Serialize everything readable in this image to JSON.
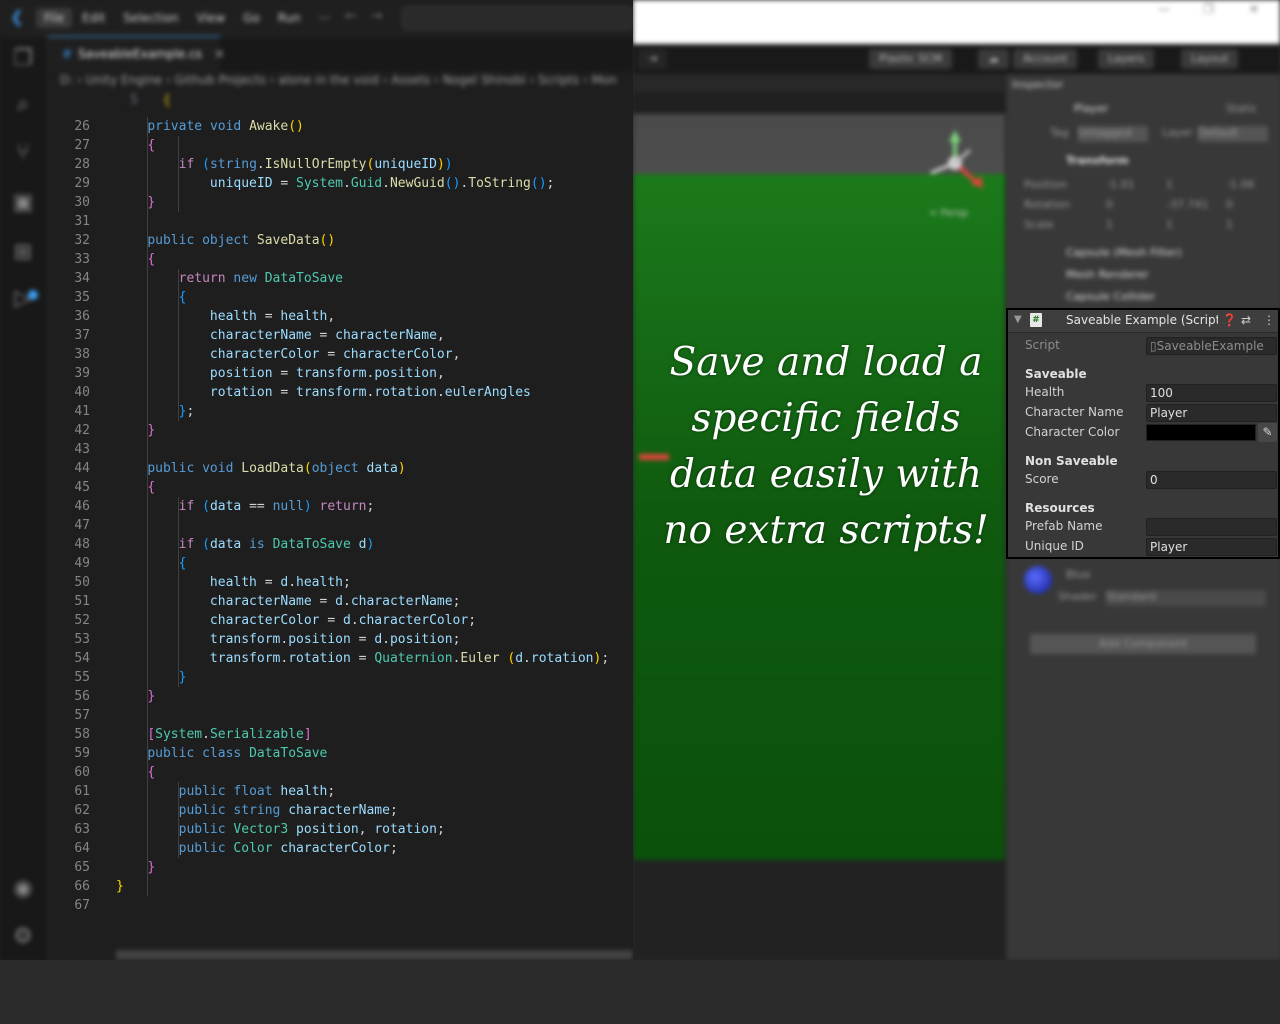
{
  "vscode": {
    "menu": [
      "File",
      "Edit",
      "Selection",
      "View",
      "Go",
      "Run",
      "···"
    ],
    "tab": {
      "filename": "SaveableExample.cs",
      "close": "×"
    },
    "breadcrumbs": "D: › Unity Engine › Github Projects › alone in the void › Assets › Nogel Shinobi › Scripts › Mon",
    "sticky": {
      "line": "5",
      "text": "{"
    },
    "lines": [
      {
        "n": "26",
        "t": [
          [
            "    ",
            "o"
          ],
          [
            "private ",
            "k"
          ],
          [
            "void ",
            "k"
          ],
          [
            "Awake",
            "f"
          ],
          [
            "()",
            "p1"
          ]
        ]
      },
      {
        "n": "27",
        "t": [
          [
            "    ",
            "o"
          ],
          [
            "{",
            "p2"
          ]
        ]
      },
      {
        "n": "28",
        "t": [
          [
            "        ",
            "o"
          ],
          [
            "if ",
            "c"
          ],
          [
            "(",
            "p3"
          ],
          [
            "string",
            "k"
          ],
          [
            ".",
            "o"
          ],
          [
            "IsNullOrEmpty",
            "f"
          ],
          [
            "(",
            "p1"
          ],
          [
            "uniqueID",
            "v"
          ],
          [
            ")",
            "p1"
          ],
          [
            ")",
            "p3"
          ]
        ]
      },
      {
        "n": "29",
        "t": [
          [
            "            ",
            "o"
          ],
          [
            "uniqueID ",
            "v"
          ],
          [
            "= ",
            "o"
          ],
          [
            "System",
            "t"
          ],
          [
            ".",
            "o"
          ],
          [
            "Guid",
            "t"
          ],
          [
            ".",
            "o"
          ],
          [
            "NewGuid",
            "f"
          ],
          [
            "()",
            "p3"
          ],
          [
            ".",
            "o"
          ],
          [
            "ToString",
            "f"
          ],
          [
            "()",
            "p3"
          ],
          [
            ";",
            "o"
          ]
        ]
      },
      {
        "n": "30",
        "t": [
          [
            "    ",
            "o"
          ],
          [
            "}",
            "p2"
          ]
        ]
      },
      {
        "n": "31",
        "t": []
      },
      {
        "n": "32",
        "t": [
          [
            "    ",
            "o"
          ],
          [
            "public ",
            "k"
          ],
          [
            "object ",
            "k"
          ],
          [
            "SaveData",
            "f"
          ],
          [
            "()",
            "p1"
          ]
        ]
      },
      {
        "n": "33",
        "t": [
          [
            "    ",
            "o"
          ],
          [
            "{",
            "p2"
          ]
        ]
      },
      {
        "n": "34",
        "t": [
          [
            "        ",
            "o"
          ],
          [
            "return ",
            "c"
          ],
          [
            "new ",
            "k"
          ],
          [
            "DataToSave",
            "t"
          ]
        ]
      },
      {
        "n": "35",
        "t": [
          [
            "        ",
            "o"
          ],
          [
            "{",
            "p3"
          ]
        ]
      },
      {
        "n": "36",
        "t": [
          [
            "            ",
            "o"
          ],
          [
            "health ",
            "v"
          ],
          [
            "= ",
            "o"
          ],
          [
            "health",
            "v"
          ],
          [
            ",",
            "o"
          ]
        ]
      },
      {
        "n": "37",
        "t": [
          [
            "            ",
            "o"
          ],
          [
            "characterName ",
            "v"
          ],
          [
            "= ",
            "o"
          ],
          [
            "characterName",
            "v"
          ],
          [
            ",",
            "o"
          ]
        ]
      },
      {
        "n": "38",
        "t": [
          [
            "            ",
            "o"
          ],
          [
            "characterColor ",
            "v"
          ],
          [
            "= ",
            "o"
          ],
          [
            "characterColor",
            "v"
          ],
          [
            ",",
            "o"
          ]
        ]
      },
      {
        "n": "39",
        "t": [
          [
            "            ",
            "o"
          ],
          [
            "position ",
            "v"
          ],
          [
            "= ",
            "o"
          ],
          [
            "transform",
            "v"
          ],
          [
            ".",
            "o"
          ],
          [
            "position",
            "v"
          ],
          [
            ",",
            "o"
          ]
        ]
      },
      {
        "n": "40",
        "t": [
          [
            "            ",
            "o"
          ],
          [
            "rotation ",
            "v"
          ],
          [
            "= ",
            "o"
          ],
          [
            "transform",
            "v"
          ],
          [
            ".",
            "o"
          ],
          [
            "rotation",
            "v"
          ],
          [
            ".",
            "o"
          ],
          [
            "eulerAngles",
            "v"
          ]
        ]
      },
      {
        "n": "41",
        "t": [
          [
            "        ",
            "o"
          ],
          [
            "}",
            "p3"
          ],
          [
            ";",
            "o"
          ]
        ]
      },
      {
        "n": "42",
        "t": [
          [
            "    ",
            "o"
          ],
          [
            "}",
            "p2"
          ]
        ]
      },
      {
        "n": "43",
        "t": []
      },
      {
        "n": "44",
        "t": [
          [
            "    ",
            "o"
          ],
          [
            "public ",
            "k"
          ],
          [
            "void ",
            "k"
          ],
          [
            "LoadData",
            "f"
          ],
          [
            "(",
            "p1"
          ],
          [
            "object ",
            "k"
          ],
          [
            "data",
            "v"
          ],
          [
            ")",
            "p1"
          ]
        ]
      },
      {
        "n": "45",
        "t": [
          [
            "    ",
            "o"
          ],
          [
            "{",
            "p2"
          ]
        ]
      },
      {
        "n": "46",
        "t": [
          [
            "        ",
            "o"
          ],
          [
            "if ",
            "c"
          ],
          [
            "(",
            "p3"
          ],
          [
            "data ",
            "v"
          ],
          [
            "== ",
            "o"
          ],
          [
            "null",
            "k"
          ],
          [
            ") ",
            "p3"
          ],
          [
            "return",
            "c"
          ],
          [
            ";",
            "o"
          ]
        ]
      },
      {
        "n": "47",
        "t": []
      },
      {
        "n": "48",
        "t": [
          [
            "        ",
            "o"
          ],
          [
            "if ",
            "c"
          ],
          [
            "(",
            "p3"
          ],
          [
            "data ",
            "v"
          ],
          [
            "is ",
            "k"
          ],
          [
            "DataToSave ",
            "t"
          ],
          [
            "d",
            "v"
          ],
          [
            ")",
            "p3"
          ]
        ]
      },
      {
        "n": "49",
        "t": [
          [
            "        ",
            "o"
          ],
          [
            "{",
            "p3"
          ]
        ]
      },
      {
        "n": "50",
        "t": [
          [
            "            ",
            "o"
          ],
          [
            "health ",
            "v"
          ],
          [
            "= ",
            "o"
          ],
          [
            "d",
            "v"
          ],
          [
            ".",
            "o"
          ],
          [
            "health",
            "v"
          ],
          [
            ";",
            "o"
          ]
        ]
      },
      {
        "n": "51",
        "t": [
          [
            "            ",
            "o"
          ],
          [
            "characterName ",
            "v"
          ],
          [
            "= ",
            "o"
          ],
          [
            "d",
            "v"
          ],
          [
            ".",
            "o"
          ],
          [
            "characterName",
            "v"
          ],
          [
            ";",
            "o"
          ]
        ]
      },
      {
        "n": "52",
        "t": [
          [
            "            ",
            "o"
          ],
          [
            "characterColor ",
            "v"
          ],
          [
            "= ",
            "o"
          ],
          [
            "d",
            "v"
          ],
          [
            ".",
            "o"
          ],
          [
            "characterColor",
            "v"
          ],
          [
            ";",
            "o"
          ]
        ]
      },
      {
        "n": "53",
        "t": [
          [
            "            ",
            "o"
          ],
          [
            "transform",
            "v"
          ],
          [
            ".",
            "o"
          ],
          [
            "position ",
            "v"
          ],
          [
            "= ",
            "o"
          ],
          [
            "d",
            "v"
          ],
          [
            ".",
            "o"
          ],
          [
            "position",
            "v"
          ],
          [
            ";",
            "o"
          ]
        ]
      },
      {
        "n": "54",
        "t": [
          [
            "            ",
            "o"
          ],
          [
            "transform",
            "v"
          ],
          [
            ".",
            "o"
          ],
          [
            "rotation ",
            "v"
          ],
          [
            "= ",
            "o"
          ],
          [
            "Quaternion",
            "t"
          ],
          [
            ".",
            "o"
          ],
          [
            "Euler ",
            "f"
          ],
          [
            "(",
            "p1"
          ],
          [
            "d",
            "v"
          ],
          [
            ".",
            "o"
          ],
          [
            "rotation",
            "v"
          ],
          [
            ")",
            "p1"
          ],
          [
            ";",
            "o"
          ]
        ]
      },
      {
        "n": "55",
        "t": [
          [
            "        ",
            "o"
          ],
          [
            "}",
            "p3"
          ]
        ]
      },
      {
        "n": "56",
        "t": [
          [
            "    ",
            "o"
          ],
          [
            "}",
            "p2"
          ]
        ]
      },
      {
        "n": "57",
        "t": []
      },
      {
        "n": "58",
        "t": [
          [
            "    ",
            "o"
          ],
          [
            "[",
            "p2"
          ],
          [
            "System",
            "t"
          ],
          [
            ".",
            "o"
          ],
          [
            "Serializable",
            "t"
          ],
          [
            "]",
            "p2"
          ]
        ]
      },
      {
        "n": "59",
        "t": [
          [
            "    ",
            "o"
          ],
          [
            "public ",
            "k"
          ],
          [
            "class ",
            "k"
          ],
          [
            "DataToSave",
            "t"
          ]
        ]
      },
      {
        "n": "60",
        "t": [
          [
            "    ",
            "o"
          ],
          [
            "{",
            "p2"
          ]
        ]
      },
      {
        "n": "61",
        "t": [
          [
            "        ",
            "o"
          ],
          [
            "public ",
            "k"
          ],
          [
            "float ",
            "k"
          ],
          [
            "health",
            "v"
          ],
          [
            ";",
            "o"
          ]
        ]
      },
      {
        "n": "62",
        "t": [
          [
            "        ",
            "o"
          ],
          [
            "public ",
            "k"
          ],
          [
            "string ",
            "k"
          ],
          [
            "characterName",
            "v"
          ],
          [
            ";",
            "o"
          ]
        ]
      },
      {
        "n": "63",
        "t": [
          [
            "        ",
            "o"
          ],
          [
            "public ",
            "k"
          ],
          [
            "Vector3 ",
            "t"
          ],
          [
            "position",
            "v"
          ],
          [
            ", ",
            "o"
          ],
          [
            "rotation",
            "v"
          ],
          [
            ";",
            "o"
          ]
        ]
      },
      {
        "n": "64",
        "t": [
          [
            "        ",
            "o"
          ],
          [
            "public ",
            "k"
          ],
          [
            "Color ",
            "t"
          ],
          [
            "characterColor",
            "v"
          ],
          [
            ";",
            "o"
          ]
        ]
      },
      {
        "n": "65",
        "t": [
          [
            "    ",
            "o"
          ],
          [
            "}",
            "p2"
          ]
        ]
      },
      {
        "n": "66",
        "t": [
          [
            "",
            "o"
          ],
          [
            "}",
            "p1"
          ]
        ]
      },
      {
        "n": "67",
        "t": []
      }
    ]
  },
  "unity": {
    "toolbar": {
      "collab": "Plastic SCM",
      "account": "Account",
      "layers": "Layers",
      "layout": "Layout"
    },
    "scene_label": "< Persp",
    "inspector": {
      "tab": "Inspector",
      "object_name": "Player",
      "static": "Static",
      "tag_label": "Tag",
      "tag_value": "Untagged",
      "layer_label": "Layer",
      "layer_value": "Default",
      "transform": {
        "title": "Transform",
        "position": {
          "label": "Position",
          "x": "-1.01",
          "y": "1",
          "z": "-1.06"
        },
        "rotation": {
          "label": "Rotation",
          "x": "0",
          "y": "-37.741",
          "z": "0"
        },
        "scale": {
          "label": "Scale",
          "x": "1",
          "y": "1",
          "z": "1"
        }
      },
      "components": [
        "Capsule (Mesh Filter)",
        "Mesh Renderer",
        "Capsule Collider"
      ],
      "material": {
        "name": "Blue",
        "shader_label": "Shader",
        "shader_value": "Standard"
      },
      "add_component": "Add Component"
    },
    "component": {
      "title": "Saveable Example (Script)",
      "script_label": "Script",
      "script_value": "SaveableExample",
      "section_saveable": "Saveable",
      "health_label": "Health",
      "health_value": "100",
      "character_name_label": "Character Name",
      "character_name_value": "Player",
      "character_color_label": "Character Color",
      "character_color": "#000000",
      "section_non_saveable": "Non Saveable",
      "score_label": "Score",
      "score_value": "0",
      "section_resources": "Resources",
      "prefab_name_label": "Prefab Name",
      "prefab_name_value": "",
      "unique_id_label": "Unique ID",
      "unique_id_value": "Player"
    }
  },
  "caption": "Save and load a specific fields data easily with no extra scripts!"
}
